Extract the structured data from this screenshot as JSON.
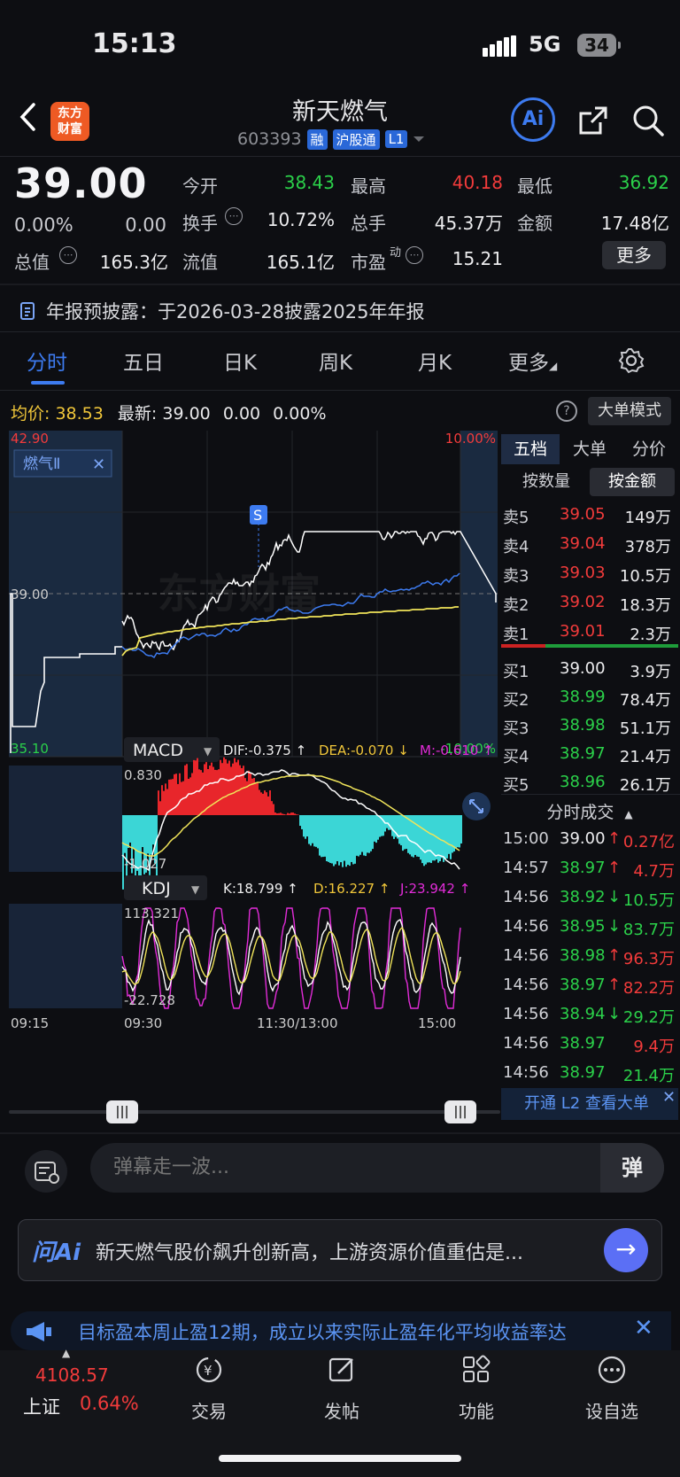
{
  "status_bar": {
    "time": "15:13",
    "network": "5G",
    "battery": "34"
  },
  "header": {
    "back_icon": "chevron-left-icon",
    "logo_text_1": "东方",
    "logo_text_2": "财富",
    "stock_name": "新天燃气",
    "stock_code": "603393",
    "tags": [
      "融",
      "沪股通",
      "L1"
    ],
    "ai_label": "Ai"
  },
  "quote": {
    "price": "39.00",
    "change_pct": "0.00%",
    "change": "0.00",
    "open_label": "今开",
    "open": "38.43",
    "high_label": "最高",
    "high": "40.18",
    "low_label": "最低",
    "low": "36.92",
    "turnover_label": "换手",
    "turnover": "10.72%",
    "volume_label": "总手",
    "volume": "45.37万",
    "amount_label": "金额",
    "amount": "17.48亿",
    "total_mv_label": "总值",
    "total_mv": "165.3亿",
    "float_mv_label": "流值",
    "float_mv": "165.1亿",
    "pe_label": "市盈",
    "pe_sup": "动",
    "pe": "15.21",
    "more_label": "更多"
  },
  "notice": "年报预披露：于2026-03-28披露2025年年报",
  "tabs": [
    "分时",
    "五日",
    "日K",
    "周K",
    "月K",
    "更多"
  ],
  "avg_row": {
    "avg_label": "均价:",
    "avg": "38.53",
    "latest_label": "最新:",
    "latest": "39.00",
    "chg": "0.00",
    "pct": "0.00%"
  },
  "big_order_btn": "大单模式",
  "chart": {
    "price_top": "42.90",
    "price_mid": "39.00",
    "price_bottom": "35.10",
    "pct_top": "10.00%",
    "pct_bottom": "-10.00%",
    "sector_tag": "燃气Ⅱ",
    "signal_marker": "S",
    "macd": {
      "label": "MACD",
      "dif": "DIF:-0.375 ↑",
      "dea": "DEA:-0.070 ↓",
      "m": "M:-0.610 ↑",
      "top": "0.830",
      "bottom": "-1.027"
    },
    "kdj": {
      "label": "KDJ",
      "k": "K:18.799 ↑",
      "d": "D:16.227 ↑",
      "j": "J:23.942 ↑",
      "top": "113.321",
      "bottom": "-22.728"
    },
    "time_labels": [
      "09:15",
      "09:30",
      "11:30/13:00",
      "15:00"
    ]
  },
  "orderbook": {
    "tabs": [
      "五档",
      "大单",
      "分价"
    ],
    "sub_tabs": [
      "按数量",
      "按金额"
    ],
    "asks": [
      {
        "label": "卖5",
        "price": "39.05",
        "amt": "149万"
      },
      {
        "label": "卖4",
        "price": "39.04",
        "amt": "378万"
      },
      {
        "label": "卖3",
        "price": "39.03",
        "amt": "10.5万"
      },
      {
        "label": "卖2",
        "price": "39.02",
        "amt": "18.3万"
      },
      {
        "label": "卖1",
        "price": "39.01",
        "amt": "2.3万"
      }
    ],
    "bids": [
      {
        "label": "买1",
        "price": "39.00",
        "amt": "3.9万"
      },
      {
        "label": "买2",
        "price": "38.99",
        "amt": "78.4万"
      },
      {
        "label": "买3",
        "price": "38.98",
        "amt": "51.1万"
      },
      {
        "label": "买4",
        "price": "38.97",
        "amt": "21.4万"
      },
      {
        "label": "买5",
        "price": "38.96",
        "amt": "26.1万"
      }
    ],
    "trades_title": "分时成交",
    "trades": [
      {
        "time": "15:00",
        "price": "39.00",
        "dir": "↑",
        "amt": "0.27亿"
      },
      {
        "time": "14:57",
        "price": "38.97",
        "dir": "↑",
        "amt": "4.7万"
      },
      {
        "time": "14:56",
        "price": "38.92",
        "dir": "↓",
        "amt": "10.5万"
      },
      {
        "time": "14:56",
        "price": "38.95",
        "dir": "↓",
        "amt": "83.7万"
      },
      {
        "time": "14:56",
        "price": "38.98",
        "dir": "↑",
        "amt": "96.3万"
      },
      {
        "time": "14:56",
        "price": "38.97",
        "dir": "↑",
        "amt": "82.2万"
      },
      {
        "time": "14:56",
        "price": "38.94",
        "dir": "↓",
        "amt": "29.2万"
      },
      {
        "time": "14:56",
        "price": "38.97",
        "dir": "",
        "amt": "9.4万"
      },
      {
        "time": "14:56",
        "price": "38.97",
        "dir": "",
        "amt": "21.4万"
      }
    ],
    "l2_banner": "开通 L2 查看大单"
  },
  "danmaku": {
    "placeholder": "弹幕走一波...",
    "send": "弹"
  },
  "ai_card": {
    "logo": "问Ai",
    "text": "新天燃气股价飙升创新高，上游资源价值重估是..."
  },
  "ticker": "目标盈本周止盈12期，成立以来实际止盈年化平均收益率达",
  "bottom_nav": {
    "index_value": "4108.57",
    "index_name": "上证",
    "index_pct": "0.64%",
    "items": [
      "交易",
      "发帖",
      "功能",
      "设自选"
    ]
  }
}
